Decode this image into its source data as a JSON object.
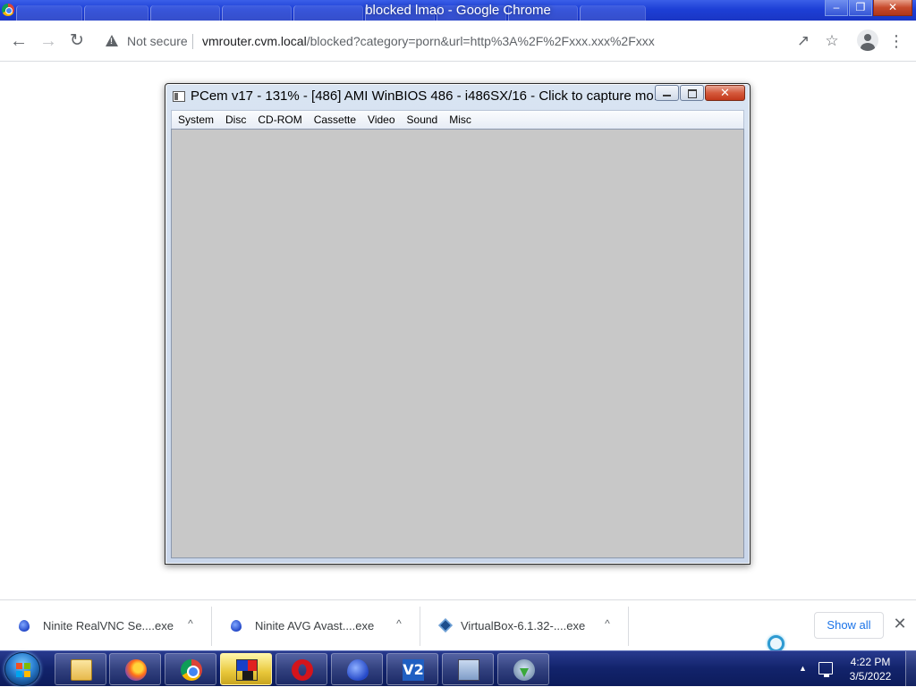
{
  "browser": {
    "window_title": "blocked lmao - Google Chrome",
    "address": {
      "security_label": "Not secure",
      "host": "vmrouter.cvm.local",
      "path": "/blocked?category=porn&url=http%3A%2F%2Fxxx.xxx%2Fxxx"
    },
    "icons": {
      "back": "back-arrow-icon",
      "forward": "forward-arrow-icon",
      "reload": "reload-icon",
      "share": "share-icon",
      "bookmark": "star-icon",
      "profile": "profile-icon",
      "menu": "kebab-menu-icon"
    }
  },
  "pcem": {
    "title": "PCem v17 - 131% - [486] AMI WinBIOS 486 - i486SX/16 - Click to capture mo...",
    "menu": [
      "System",
      "Disc",
      "CD-ROM",
      "Cassette",
      "Video",
      "Sound",
      "Misc"
    ],
    "screen_color": "#c8c8c8"
  },
  "downloads": {
    "items": [
      {
        "name": "Ninite RealVNC Se....exe",
        "icon": "ninite-icon"
      },
      {
        "name": "Ninite AVG Avast....exe",
        "icon": "ninite-icon"
      },
      {
        "name": "VirtualBox-6.1.32-....exe",
        "icon": "virtualbox-icon"
      }
    ],
    "show_all": "Show all"
  },
  "taskbar": {
    "apps": [
      {
        "name": "windows-explorer",
        "icon": "folder-icon"
      },
      {
        "name": "firefox",
        "icon": "firefox-icon"
      },
      {
        "name": "chrome",
        "icon": "chrome-icon"
      },
      {
        "name": "pcem",
        "icon": "pcem-icon",
        "active": true
      },
      {
        "name": "opera",
        "icon": "opera-icon"
      },
      {
        "name": "ninite",
        "icon": "ninite-icon"
      },
      {
        "name": "vnc",
        "icon": "vnc-icon"
      },
      {
        "name": "remote-desktop",
        "icon": "remote-desktop-icon"
      },
      {
        "name": "downloader",
        "icon": "download-icon"
      }
    ],
    "clock": {
      "time": "4:22 PM",
      "date": "3/5/2022"
    }
  }
}
